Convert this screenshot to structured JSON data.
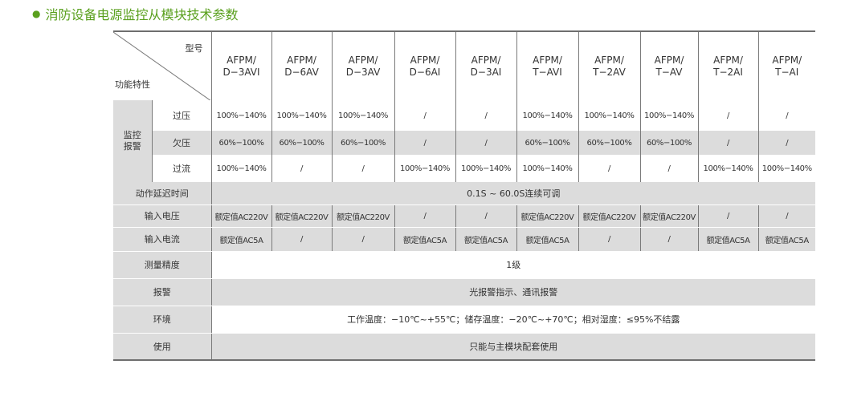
{
  "title": "消防设备电源监控从模块技术参数",
  "header": {
    "corner_top": "型号",
    "corner_bottom": "功能特性",
    "models": [
      [
        "AFPM/",
        "D−3AVI"
      ],
      [
        "AFPM/",
        "D−6AV"
      ],
      [
        "AFPM/",
        "D−3AV"
      ],
      [
        "AFPM/",
        "D−6AI"
      ],
      [
        "AFPM/",
        "D−3AI"
      ],
      [
        "AFPM/",
        "T−AVI"
      ],
      [
        "AFPM/",
        "T−2AV"
      ],
      [
        "AFPM/",
        "T−AV"
      ],
      [
        "AFPM/",
        "T−2AI"
      ],
      [
        "AFPM/",
        "T−AI"
      ]
    ]
  },
  "monitor": {
    "group_label": "监控\n报警",
    "rows": [
      {
        "label": "过压",
        "values": [
          "100%−140%",
          "100%−140%",
          "100%−140%",
          "/",
          "/",
          "100%−140%",
          "100%−140%",
          "100%−140%",
          "/",
          "/"
        ]
      },
      {
        "label": "欠压",
        "values": [
          "60%−100%",
          "60%−100%",
          "60%−100%",
          "/",
          "/",
          "60%−100%",
          "60%−100%",
          "60%−100%",
          "/",
          "/"
        ]
      },
      {
        "label": "过流",
        "values": [
          "100%−140%",
          "/",
          "/",
          "100%−140%",
          "100%−140%",
          "100%−140%",
          "/",
          "/",
          "100%−140%",
          "100%−140%"
        ]
      }
    ]
  },
  "delay": {
    "label": "动作延迟时间",
    "value": "0.1S ~ 60.0S连续可调"
  },
  "input_voltage": {
    "label": "输入电压",
    "values": [
      "额定值AC220V",
      "额定值AC220V",
      "额定值AC220V",
      "/",
      "/",
      "额定值AC220V",
      "额定值AC220V",
      "额定值AC220V",
      "/",
      "/"
    ]
  },
  "input_current": {
    "label": "输入电流",
    "values": [
      "额定值AC5A",
      "/",
      "/",
      "额定值AC5A",
      "额定值AC5A",
      "额定值AC5A",
      "/",
      "/",
      "额定值AC5A",
      "额定值AC5A"
    ]
  },
  "accuracy": {
    "label": "测量精度",
    "value": "1级"
  },
  "alarm": {
    "label": "报警",
    "value": "光报警指示、通讯报警"
  },
  "environment": {
    "label": "环境",
    "value": "工作温度：−10℃~+55℃；储存温度：−20℃~+70℃；相对湿度：≤95%不结露"
  },
  "usage": {
    "label": "使用",
    "value": "只能与主模块配套使用"
  }
}
